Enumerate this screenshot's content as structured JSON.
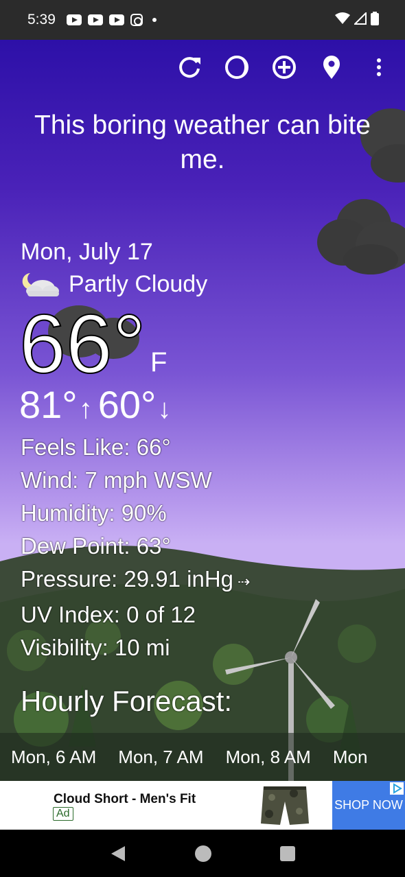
{
  "status_bar": {
    "time": "5:39"
  },
  "toolbar": {
    "refresh_icon": "refresh-icon",
    "moon_icon": "moon-phase-icon",
    "add_icon": "add-location-icon",
    "location_icon": "location-pin-icon",
    "menu_icon": "more-vert-icon"
  },
  "headline": "This boring weather can bite me.",
  "current": {
    "date": "Mon, July 17",
    "condition": "Partly Cloudy",
    "temperature": "66°",
    "unit": "F",
    "high": "81°",
    "low": "60°"
  },
  "details": [
    "Feels Like:  66°",
    "Wind:  7 mph WSW",
    "Humidity:  90%",
    "Dew Point:  63°",
    "Pressure:  29.91 inHg",
    "UV Index:  0 of 12",
    "Visibility:  10 mi"
  ],
  "hourly": {
    "title": "Hourly Forecast:",
    "items": [
      "Mon, 6 AM",
      "Mon, 7 AM",
      "Mon, 8 AM",
      "Mon"
    ]
  },
  "ad": {
    "title": "Cloud Short - Men's Fit",
    "badge": "Ad",
    "cta": "SHOP NOW"
  }
}
